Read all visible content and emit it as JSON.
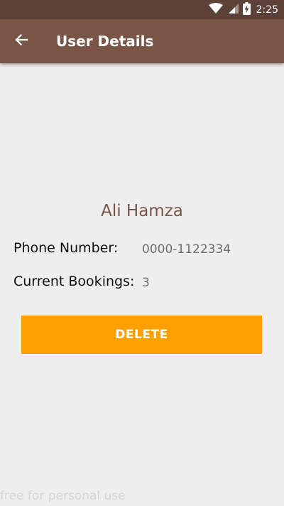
{
  "status_bar": {
    "time": "2:25",
    "icons": [
      "wifi-icon",
      "cellular-signal-icon",
      "battery-charging-icon"
    ]
  },
  "app_bar": {
    "title": "User Details",
    "back_icon": "arrow-back-icon"
  },
  "user": {
    "name": "Ali Hamza",
    "phone_label": "Phone Number:",
    "phone_value": "0000-1122334",
    "bookings_label": "Current Bookings:",
    "bookings_value": "3"
  },
  "actions": {
    "delete_label": "DELETE"
  },
  "watermark": "free for personal use",
  "colors": {
    "status_bar": "#5d4037",
    "app_bar": "#795548",
    "accent": "#ffa000",
    "background": "#eeeeee"
  }
}
